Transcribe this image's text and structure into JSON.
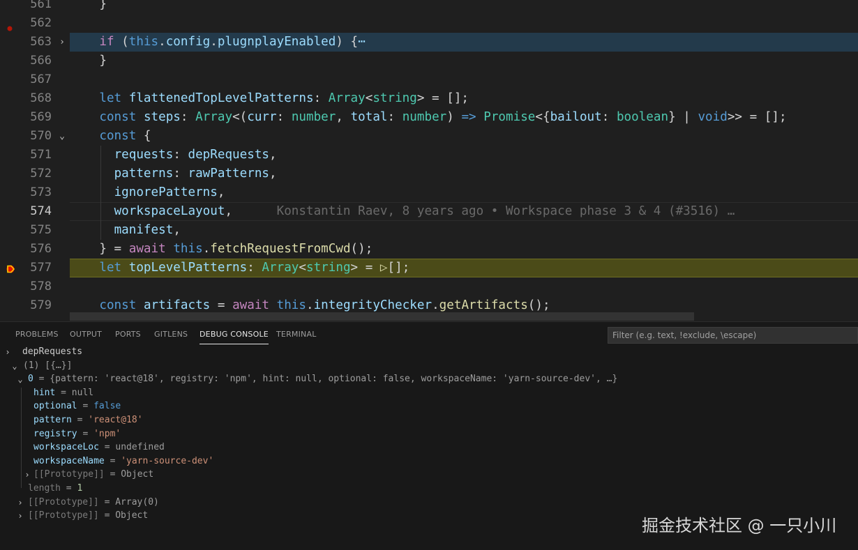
{
  "editor": {
    "lines": [
      {
        "num": "561",
        "tokens": [
          {
            "t": "    }",
            "c": "p"
          }
        ]
      },
      {
        "num": "562",
        "breakpoint": "dot",
        "tokens": []
      },
      {
        "num": "563",
        "fold": "›",
        "highlight": "blue",
        "tokens": [
          {
            "t": "    ",
            "c": "p"
          },
          {
            "t": "if",
            "c": "c"
          },
          {
            "t": " (",
            "c": "p"
          },
          {
            "t": "this",
            "c": "k"
          },
          {
            "t": ".",
            "c": "p"
          },
          {
            "t": "config",
            "c": "v"
          },
          {
            "t": ".",
            "c": "p"
          },
          {
            "t": "plugnplayEnabled",
            "c": "v"
          },
          {
            "t": ") {",
            "c": "p"
          },
          {
            "t": "⋯",
            "c": "v"
          }
        ]
      },
      {
        "num": "566",
        "tokens": [
          {
            "t": "    }",
            "c": "p"
          }
        ]
      },
      {
        "num": "567",
        "tokens": []
      },
      {
        "num": "568",
        "tokens": [
          {
            "t": "    ",
            "c": "p"
          },
          {
            "t": "let",
            "c": "k"
          },
          {
            "t": " ",
            "c": "p"
          },
          {
            "t": "flattenedTopLevelPatterns",
            "c": "v"
          },
          {
            "t": ": ",
            "c": "p"
          },
          {
            "t": "Array",
            "c": "t"
          },
          {
            "t": "<",
            "c": "p"
          },
          {
            "t": "string",
            "c": "t"
          },
          {
            "t": "> = [];",
            "c": "p"
          }
        ]
      },
      {
        "num": "569",
        "tokens": [
          {
            "t": "    ",
            "c": "p"
          },
          {
            "t": "const",
            "c": "k"
          },
          {
            "t": " ",
            "c": "p"
          },
          {
            "t": "steps",
            "c": "v"
          },
          {
            "t": ": ",
            "c": "p"
          },
          {
            "t": "Array",
            "c": "t"
          },
          {
            "t": "<(",
            "c": "p"
          },
          {
            "t": "curr",
            "c": "v"
          },
          {
            "t": ": ",
            "c": "p"
          },
          {
            "t": "number",
            "c": "t"
          },
          {
            "t": ", ",
            "c": "p"
          },
          {
            "t": "total",
            "c": "v"
          },
          {
            "t": ": ",
            "c": "p"
          },
          {
            "t": "number",
            "c": "t"
          },
          {
            "t": ") ",
            "c": "p"
          },
          {
            "t": "=>",
            "c": "k"
          },
          {
            "t": " ",
            "c": "p"
          },
          {
            "t": "Promise",
            "c": "t"
          },
          {
            "t": "<{",
            "c": "p"
          },
          {
            "t": "bailout",
            "c": "v"
          },
          {
            "t": ": ",
            "c": "p"
          },
          {
            "t": "boolean",
            "c": "t"
          },
          {
            "t": "} | ",
            "c": "p"
          },
          {
            "t": "void",
            "c": "k"
          },
          {
            "t": ">> = [];",
            "c": "p"
          }
        ]
      },
      {
        "num": "570",
        "fold": "⌄",
        "tokens": [
          {
            "t": "    ",
            "c": "p"
          },
          {
            "t": "const",
            "c": "k"
          },
          {
            "t": " {",
            "c": "p"
          }
        ]
      },
      {
        "num": "571",
        "tokens": [
          {
            "t": "      ",
            "c": "p"
          },
          {
            "t": "requests",
            "c": "v"
          },
          {
            "t": ": ",
            "c": "p"
          },
          {
            "t": "depRequests",
            "c": "v"
          },
          {
            "t": ",",
            "c": "p"
          }
        ]
      },
      {
        "num": "572",
        "tokens": [
          {
            "t": "      ",
            "c": "p"
          },
          {
            "t": "patterns",
            "c": "v"
          },
          {
            "t": ": ",
            "c": "p"
          },
          {
            "t": "rawPatterns",
            "c": "v"
          },
          {
            "t": ",",
            "c": "p"
          }
        ]
      },
      {
        "num": "573",
        "tokens": [
          {
            "t": "      ",
            "c": "p"
          },
          {
            "t": "ignorePatterns",
            "c": "v"
          },
          {
            "t": ",",
            "c": "p"
          }
        ]
      },
      {
        "num": "574",
        "current": true,
        "tokens": [
          {
            "t": "      ",
            "c": "p"
          },
          {
            "t": "workspaceLayout",
            "c": "v"
          },
          {
            "t": ",",
            "c": "p"
          },
          {
            "t": "      Konstantin Raev, 8 years ago • Workspace phase 3 & 4 (#3516) …",
            "c": "blame"
          }
        ]
      },
      {
        "num": "575",
        "tokens": [
          {
            "t": "      ",
            "c": "p"
          },
          {
            "t": "manifest",
            "c": "v"
          },
          {
            "t": ",",
            "c": "p"
          }
        ]
      },
      {
        "num": "576",
        "tokens": [
          {
            "t": "    } = ",
            "c": "p"
          },
          {
            "t": "await",
            "c": "c"
          },
          {
            "t": " ",
            "c": "p"
          },
          {
            "t": "this",
            "c": "k"
          },
          {
            "t": ".",
            "c": "p"
          },
          {
            "t": "fetchRequestFromCwd",
            "c": "f"
          },
          {
            "t": "();",
            "c": "p"
          }
        ]
      },
      {
        "num": "577",
        "breakpoint": "arrow",
        "highlight": "yellow",
        "tokens": [
          {
            "t": "    ",
            "c": "p"
          },
          {
            "t": "let",
            "c": "k"
          },
          {
            "t": " ",
            "c": "p"
          },
          {
            "t": "topLevelPatterns",
            "c": "v"
          },
          {
            "t": ": ",
            "c": "p"
          },
          {
            "t": "Array",
            "c": "t"
          },
          {
            "t": "<",
            "c": "p"
          },
          {
            "t": "string",
            "c": "t"
          },
          {
            "t": "> = ",
            "c": "p"
          },
          {
            "t": "▷",
            "c": "f"
          },
          {
            "t": "[];",
            "c": "p"
          }
        ]
      },
      {
        "num": "578",
        "tokens": []
      },
      {
        "num": "579",
        "tokens": [
          {
            "t": "    ",
            "c": "p"
          },
          {
            "t": "const",
            "c": "k"
          },
          {
            "t": " ",
            "c": "p"
          },
          {
            "t": "artifacts",
            "c": "v"
          },
          {
            "t": " = ",
            "c": "p"
          },
          {
            "t": "await",
            "c": "c"
          },
          {
            "t": " ",
            "c": "p"
          },
          {
            "t": "this",
            "c": "k"
          },
          {
            "t": ".",
            "c": "p"
          },
          {
            "t": "integrityChecker",
            "c": "v"
          },
          {
            "t": ".",
            "c": "p"
          },
          {
            "t": "getArtifacts",
            "c": "f"
          },
          {
            "t": "();",
            "c": "p"
          }
        ]
      }
    ]
  },
  "panel": {
    "tabs": [
      {
        "label": "PROBLEMS"
      },
      {
        "label": "OUTPUT"
      },
      {
        "label": "PORTS"
      },
      {
        "label": "GITLENS"
      },
      {
        "label": "DEBUG CONSOLE",
        "active": true
      },
      {
        "label": "TERMINAL"
      }
    ],
    "filter_placeholder": "Filter (e.g. text, !exclude, \\escape)",
    "console": [
      {
        "indent": 0,
        "twisty": "›",
        "parts": [
          {
            "t": "depRequests",
            "c": "pv-gray-light"
          }
        ]
      },
      {
        "indent": 1,
        "twisty": "⌄",
        "parts": [
          {
            "t": "(1) [{…}]",
            "c": "pv-gray"
          }
        ]
      },
      {
        "indent": 2,
        "twisty": "⌄",
        "parts": [
          {
            "t": "0",
            "c": "pk"
          },
          {
            "t": " = {pattern: 'react@18', registry: 'npm', hint: null, optional: false, workspaceName: 'yarn-source-dev', …}",
            "c": "pv-gray"
          }
        ]
      },
      {
        "indent": 3,
        "parts": [
          {
            "t": "hint",
            "c": "pk"
          },
          {
            "t": " = ",
            "c": "pv-gray"
          },
          {
            "t": "null",
            "c": "pv-gray"
          }
        ]
      },
      {
        "indent": 3,
        "parts": [
          {
            "t": "optional",
            "c": "pk"
          },
          {
            "t": " = ",
            "c": "pv-gray"
          },
          {
            "t": "false",
            "c": "pv-kw"
          }
        ]
      },
      {
        "indent": 3,
        "parts": [
          {
            "t": "pattern",
            "c": "pk"
          },
          {
            "t": " = ",
            "c": "pv-gray"
          },
          {
            "t": "'react@18'",
            "c": "pv-str"
          }
        ]
      },
      {
        "indent": 3,
        "parts": [
          {
            "t": "registry",
            "c": "pk"
          },
          {
            "t": " = ",
            "c": "pv-gray"
          },
          {
            "t": "'npm'",
            "c": "pv-str"
          }
        ]
      },
      {
        "indent": 3,
        "parts": [
          {
            "t": "workspaceLoc",
            "c": "pk"
          },
          {
            "t": " = ",
            "c": "pv-gray"
          },
          {
            "t": "undefined",
            "c": "pv-undef"
          }
        ]
      },
      {
        "indent": 3,
        "parts": [
          {
            "t": "workspaceName",
            "c": "pk"
          },
          {
            "t": " = ",
            "c": "pv-gray"
          },
          {
            "t": "'yarn-source-dev'",
            "c": "pv-str"
          }
        ]
      },
      {
        "indent": 3,
        "twisty": "›",
        "parts": [
          {
            "t": "[[Prototype]]",
            "c": "proto"
          },
          {
            "t": " = Object",
            "c": "pv-gray"
          }
        ]
      },
      {
        "indent": 2,
        "parts": [
          {
            "t": "length",
            "c": "proto"
          },
          {
            "t": " = ",
            "c": "pv-gray"
          },
          {
            "t": "1",
            "c": "pv-num"
          }
        ]
      },
      {
        "indent": 2,
        "twisty": "›",
        "parts": [
          {
            "t": "[[Prototype]]",
            "c": "proto"
          },
          {
            "t": " = Array(0)",
            "c": "pv-gray"
          }
        ]
      },
      {
        "indent": 2,
        "twisty": "›",
        "parts": [
          {
            "t": "[[Prototype]]",
            "c": "proto"
          },
          {
            "t": " = Object",
            "c": "pv-gray"
          }
        ]
      }
    ]
  },
  "watermark": "掘金技术社区 @ 一只小川",
  "colors": {
    "breakpoint": "#e51400",
    "debug_arrow": "#ffcc00",
    "editor_bg": "#1f1f1f",
    "panel_bg": "#181818"
  }
}
